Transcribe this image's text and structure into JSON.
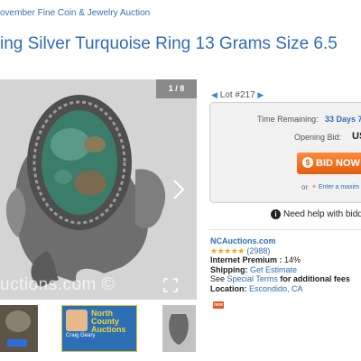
{
  "breadcrumb": "ovember Fine Coin & Jewelry Auction",
  "title": "ing Silver Turquoise Ring 13 Grams Size 6.5",
  "gallery": {
    "counter": "1 / 8",
    "watermark": "uctions.com ©",
    "thumb_ad": {
      "title": "North County Auctions",
      "subtitle": "Craig Geary"
    }
  },
  "lot": {
    "label": "Lot #217",
    "prev_icon": "left-arrow-icon",
    "next_icon": "right-arrow-icon"
  },
  "bid_panel": {
    "time_remaining_label": "Time Remaining:",
    "time_remaining_value": "33 Days 7",
    "opening_bid_label": "Opening Bid:",
    "opening_bid_value": "US",
    "bid_button": "BID NOW",
    "or_text": "or",
    "max_bid_link": "Enter a maxim"
  },
  "help_text": "Need help with biddi",
  "seller": {
    "name": "NCAuctions.com",
    "stars": "★★★★★",
    "review_count": "(2988)",
    "premium_label": "Internet Premium :",
    "premium_value": "14%",
    "shipping_label": "Shipping:",
    "shipping_value": "Get Estimate",
    "terms_pre": "See",
    "terms_link": "Special Terms",
    "terms_post": "for additional fees",
    "location_label": "Location:",
    "location_value": "Escondido, CA",
    "badge": "new"
  },
  "colors": {
    "link": "#2f6db5",
    "bid_button": "#f07020",
    "stars": "#f2a81b"
  }
}
